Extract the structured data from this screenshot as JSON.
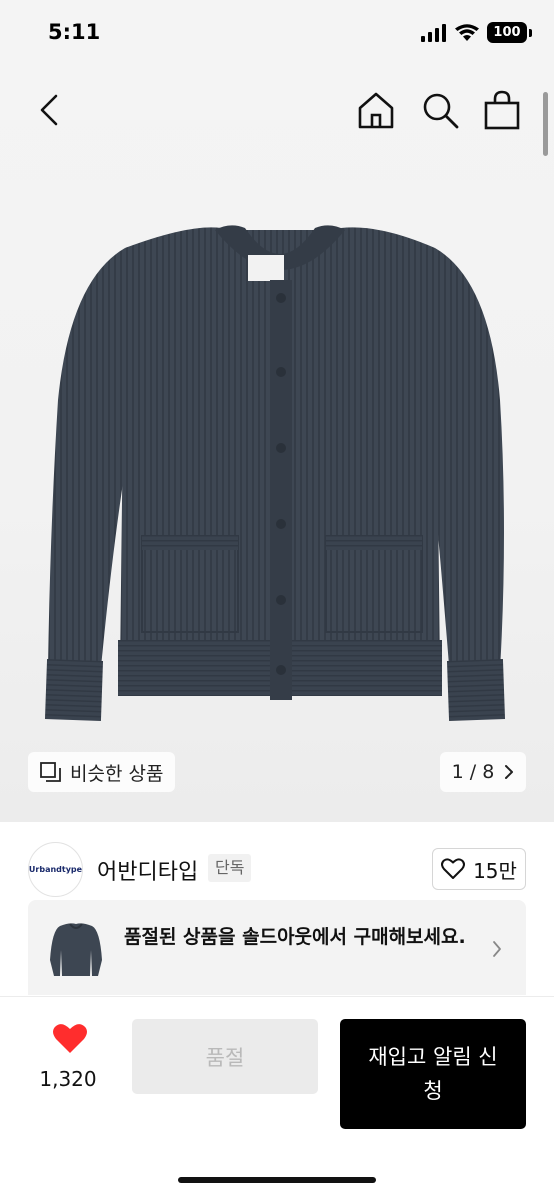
{
  "status_bar": {
    "time": "5:11",
    "battery": "100"
  },
  "nav": {
    "back_icon": "chevron-left-icon",
    "home_icon": "home-icon",
    "search_icon": "search-icon",
    "bag_icon": "shopping-bag-icon"
  },
  "gallery": {
    "similar_label": "비슷한 상품",
    "page_indicator": "1 / 8"
  },
  "brand": {
    "logo_text": "Urbandtype",
    "name": "어반디타입",
    "tag": "단독",
    "likes": "15만"
  },
  "soldout_banner": {
    "text": "품절된 상품을 솔드아웃에서 구매해보세요."
  },
  "bottom": {
    "wish_count": "1,320",
    "soldout_label": "품절",
    "restock_label": "재입고 알림 신청"
  },
  "colors": {
    "accent": "#000000",
    "heart": "#ff2d2d",
    "sweater": "#3d4652"
  }
}
